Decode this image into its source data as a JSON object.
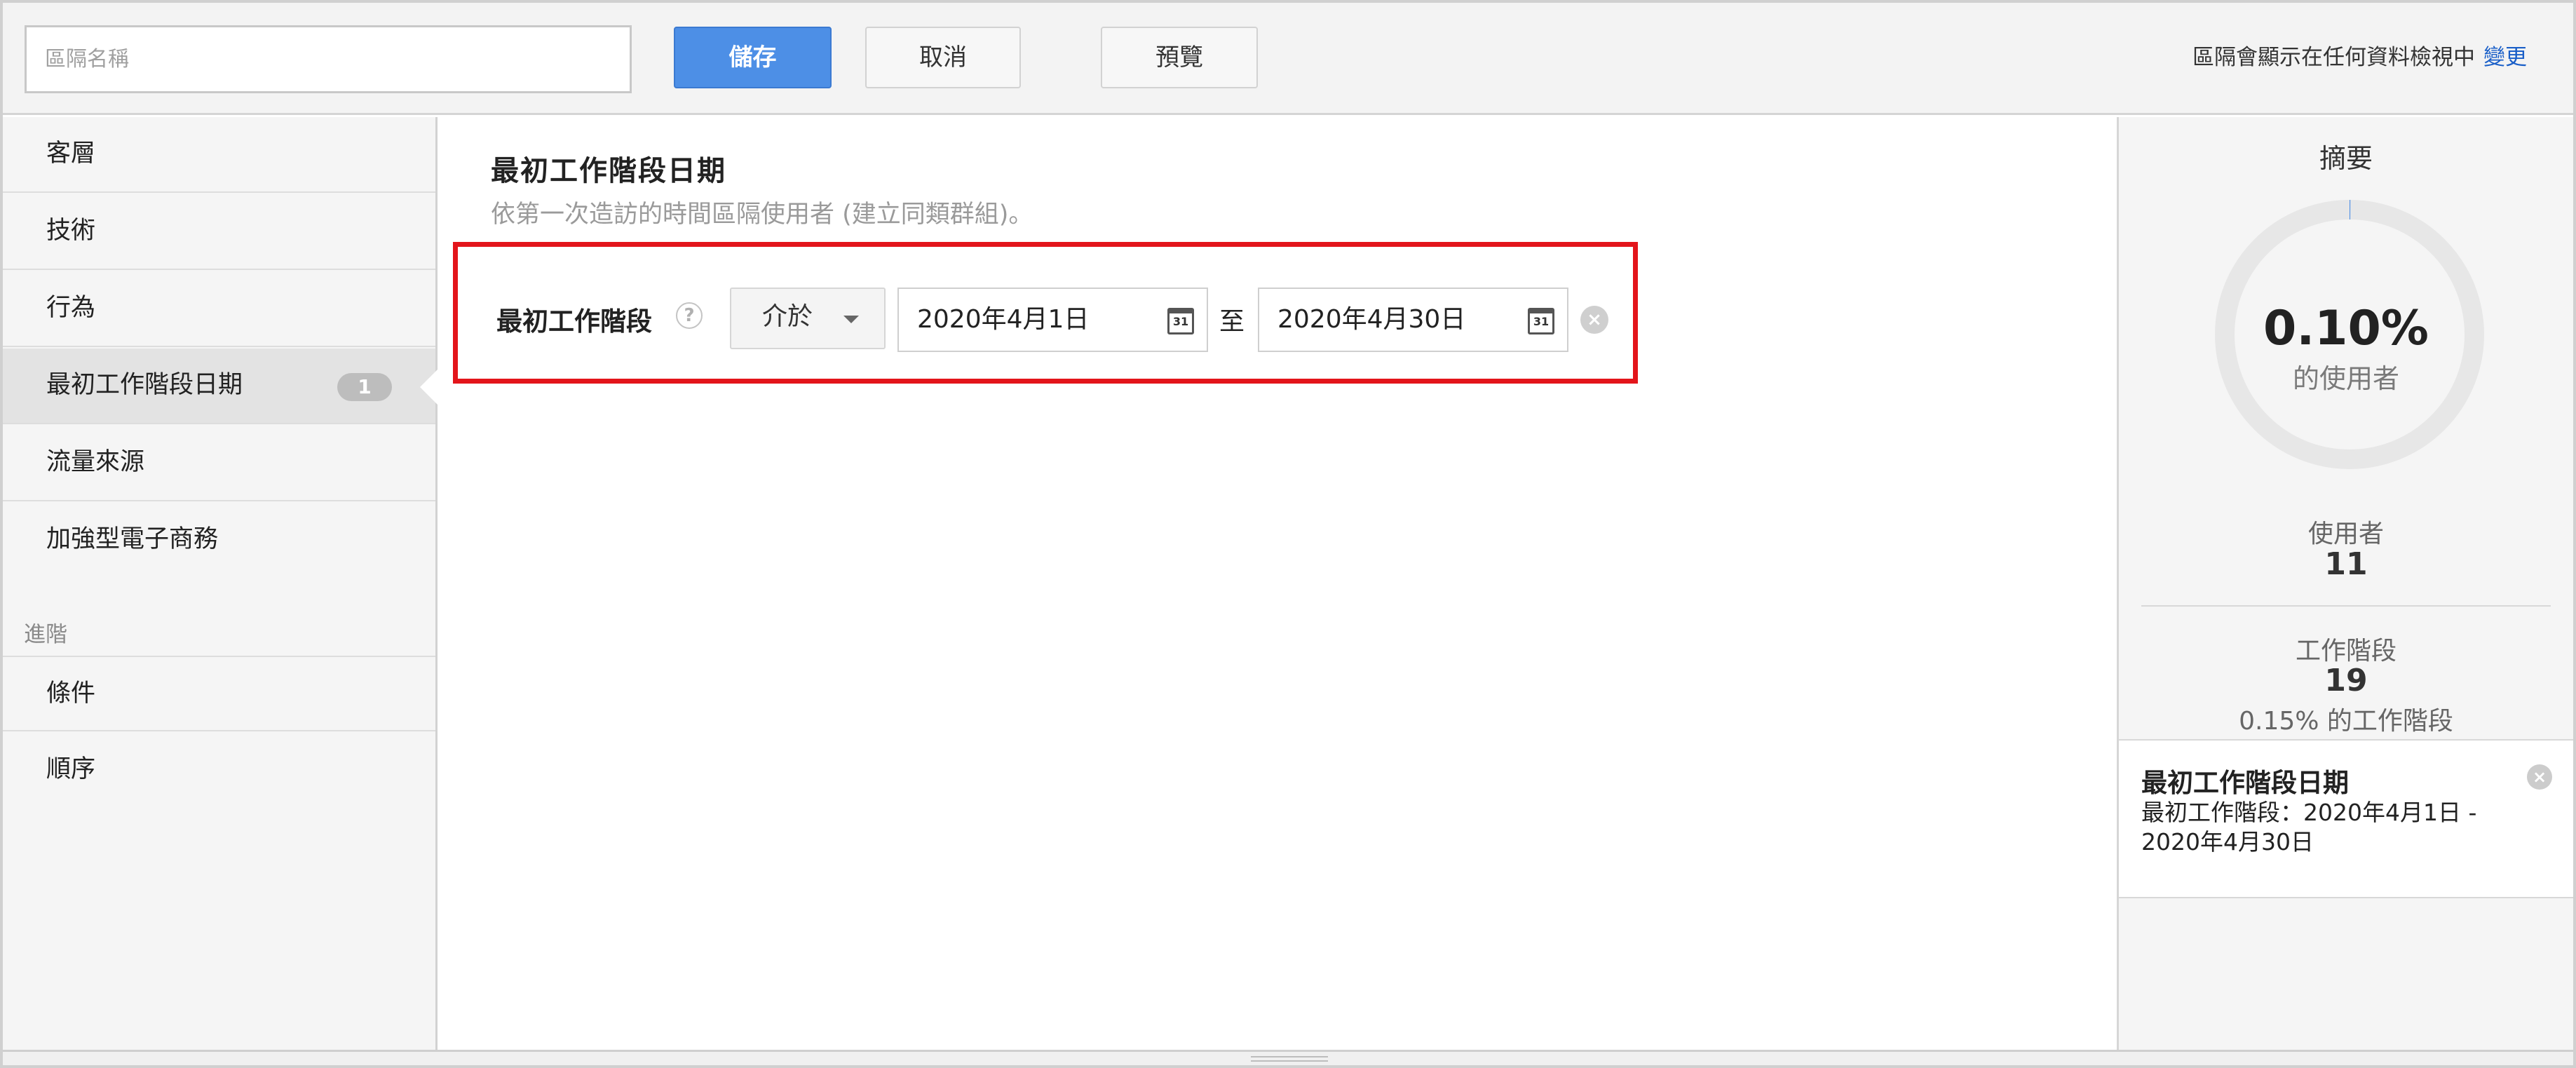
{
  "toolbar": {
    "segment_name_placeholder": "區隔名稱",
    "save_label": "儲存",
    "cancel_label": "取消",
    "preview_label": "預覽",
    "visibility_note": "區隔會顯示在任何資料檢視中",
    "change_label": "變更"
  },
  "sidebar": {
    "items": [
      {
        "label": "客層"
      },
      {
        "label": "技術"
      },
      {
        "label": "行為"
      },
      {
        "label": "最初工作階段日期",
        "count": "1",
        "active": true
      },
      {
        "label": "流量來源"
      },
      {
        "label": "加強型電子商務"
      }
    ],
    "advanced_header": "進階",
    "advanced_items": [
      {
        "label": "條件"
      },
      {
        "label": "順序"
      }
    ]
  },
  "main": {
    "title": "最初工作階段日期",
    "description": "依第一次造訪的時間區隔使用者 (建立同類群組)。",
    "condition": {
      "label": "最初工作階段",
      "help_icon": "?",
      "operator": "介於",
      "from_date": "2020年4月1日",
      "separator": "至",
      "to_date": "2020年4月30日",
      "calendar_icon_text": "31"
    },
    "highlight_color": "#e3151b"
  },
  "summary": {
    "title": "摘要",
    "percent_users": "0.10%",
    "percent_users_label": "的使用者",
    "donut_fraction": 0.001,
    "users_label": "使用者",
    "users_value": "11",
    "sessions_label": "工作階段",
    "sessions_value": "19",
    "sessions_note": "0.15% 的工作階段",
    "condition_card": {
      "title": "最初工作階段日期",
      "detail": "最初工作階段：2020年4月1日 - 2020年4月30日"
    }
  },
  "colors": {
    "accent_blue": "#4d8fe6",
    "link_blue": "#1a5fc8",
    "donut_ring": "#e7e7e7"
  }
}
